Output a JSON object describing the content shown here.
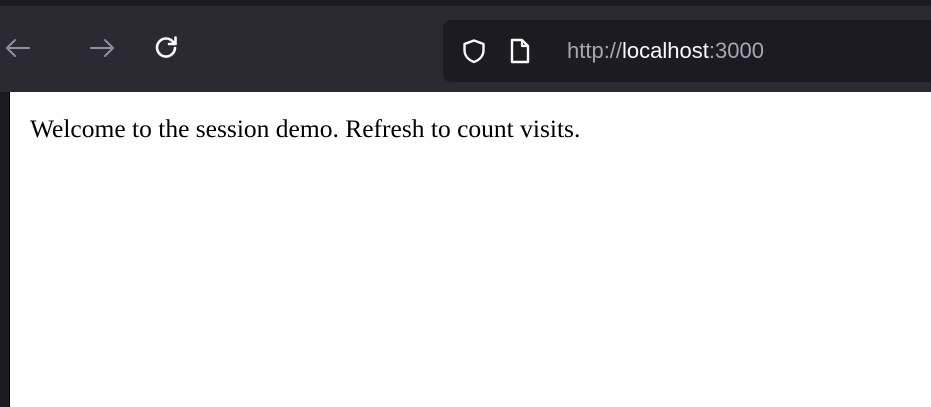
{
  "toolbar": {
    "back_icon": "arrow-left-icon",
    "forward_icon": "arrow-right-icon",
    "reload_icon": "reload-icon"
  },
  "urlbar": {
    "shield_icon": "tracking-protection-shield-icon",
    "page_icon": "page-info-icon",
    "scheme": "http://",
    "host": "localhost",
    "port": ":3000"
  },
  "page": {
    "body_text": "Welcome to the session demo. Refresh to count visits."
  },
  "colors": {
    "toolbar_bg": "#2b2a33",
    "urlbar_bg": "#1c1b22",
    "icon_active": "#fbfbfe",
    "icon_disabled": "#8f8f9d",
    "content_bg": "#ffffff"
  }
}
